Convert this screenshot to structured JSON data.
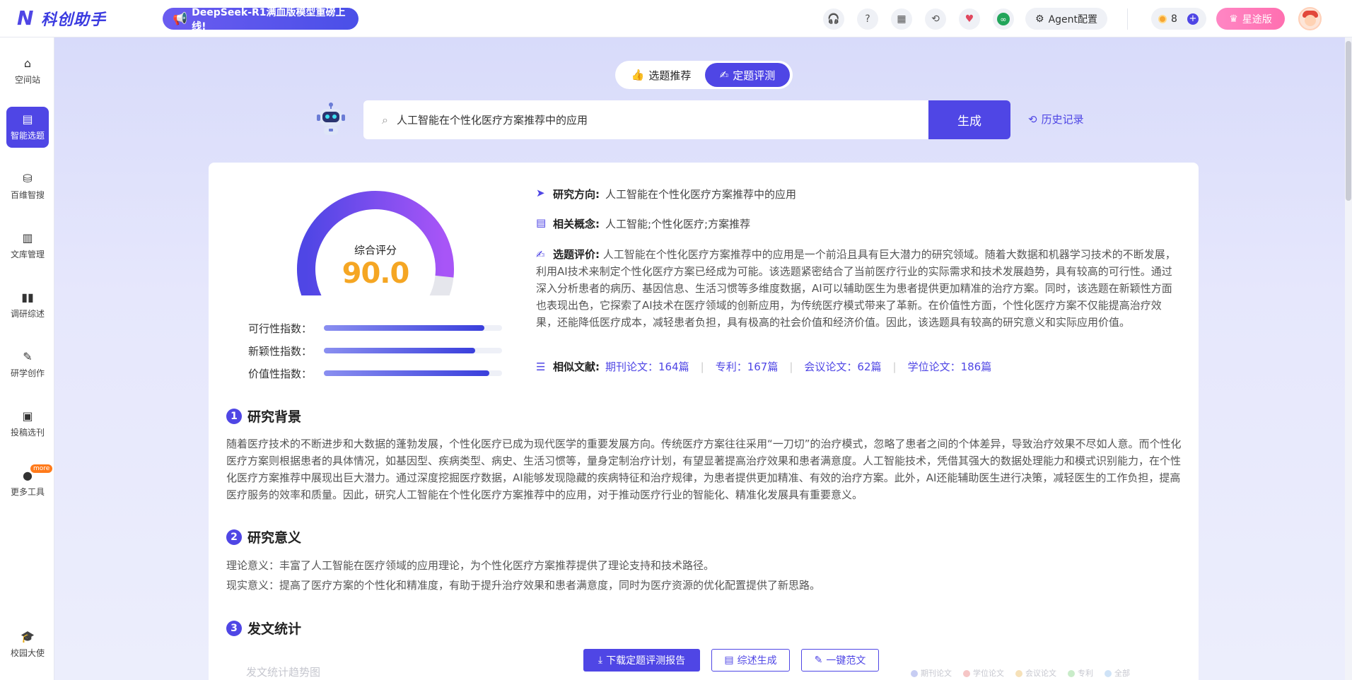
{
  "app": {
    "logo_text": "科创助手",
    "promo": "DeepSeek-R1满血版模型重磅上线!",
    "agent_label": "Agent配置",
    "coins": "8",
    "vip_label": "星途版"
  },
  "sidebar": {
    "items": [
      {
        "label": "空间站",
        "icon": "home-icon"
      },
      {
        "label": "智能选题",
        "icon": "clipboard-icon"
      },
      {
        "label": "百维智搜",
        "icon": "search-db-icon"
      },
      {
        "label": "文库管理",
        "icon": "library-icon"
      },
      {
        "label": "调研综述",
        "icon": "book-icon"
      },
      {
        "label": "研学创作",
        "icon": "edit-icon"
      },
      {
        "label": "投稿选刊",
        "icon": "submit-icon"
      },
      {
        "label": "更多工具",
        "icon": "more-icon"
      },
      {
        "label": "校园大使",
        "icon": "graduation-cap-icon"
      }
    ],
    "more_badge": "more"
  },
  "tabs": {
    "recommend": "选题推荐",
    "evaluate": "定题评测"
  },
  "search": {
    "value": "人工智能在个性化医疗方案推荐中的应用",
    "generate": "生成",
    "history": "历史记录"
  },
  "score": {
    "label": "综合评分",
    "value": "90.0",
    "fraction": 0.9,
    "colors": {
      "start": "#4f46e5",
      "end": "#a855f7",
      "remainder": "#e5e6ec",
      "value": "#f5a623"
    },
    "metrics": [
      {
        "label": "可行性指数：",
        "fraction": 0.9
      },
      {
        "label": "新颖性指数：",
        "fraction": 0.85
      },
      {
        "label": "价值性指数：",
        "fraction": 0.93
      }
    ]
  },
  "info": {
    "direction_title": "研究方向:",
    "direction_value": "人工智能在个性化医疗方案推荐中的应用",
    "concept_title": "相关概念:",
    "concept_value": "人工智能;个性化医疗;方案推荐",
    "eval_title": "选题评价:",
    "eval_value": "人工智能在个性化医疗方案推荐中的应用是一个前沿且具有巨大潜力的研究领域。随着大数据和机器学习技术的不断发展，利用AI技术来制定个性化医疗方案已经成为可能。该选题紧密结合了当前医疗行业的实际需求和技术发展趋势，具有较高的可行性。通过深入分析患者的病历、基因信息、生活习惯等多维度数据，AI可以辅助医生为患者提供更加精准的治疗方案。同时，该选题在新颖性方面也表现出色，它探索了AI技术在医疗领域的创新应用，为传统医疗模式带来了革新。在价值性方面，个性化医疗方案不仅能提高治疗效果，还能降低医疗成本，减轻患者负担，具有极高的社会价值和经济价值。因此，该选题具有较高的研究意义和实际应用价值。",
    "refs_title": "相似文献:",
    "refs": [
      "期刊论文：164篇",
      "专利：167篇",
      "会议论文：62篇",
      "学位论文：186篇"
    ]
  },
  "sections": {
    "s1_num": "1",
    "s1_title": "研究背景",
    "s1_text": "随着医疗技术的不断进步和大数据的蓬勃发展，个性化医疗已成为现代医学的重要发展方向。传统医疗方案往往采用“一刀切”的治疗模式，忽略了患者之间的个体差异，导致治疗效果不尽如人意。而个性化医疗方案则根据患者的具体情况，如基因型、疾病类型、病史、生活习惯等，量身定制治疗计划，有望显著提高治疗效果和患者满意度。人工智能技术，凭借其强大的数据处理能力和模式识别能力，在个性化医疗方案推荐中展现出巨大潜力。通过深度挖掘医疗数据，AI能够发现隐藏的疾病特征和治疗规律，为患者提供更加精准、有效的治疗方案。此外，AI还能辅助医生进行决策，减轻医生的工作负担，提高医疗服务的效率和质量。因此，研究人工智能在个性化医疗方案推荐中的应用，对于推动医疗行业的智能化、精准化发展具有重要意义。",
    "s2_num": "2",
    "s2_title": "研究意义",
    "s2_line1": "理论意义：丰富了人工智能在医疗领域的应用理论，为个性化医疗方案推荐提供了理论支持和技术路径。",
    "s2_line2": "现实意义：提高了医疗方案的个性化和精准度，有助于提升治疗效果和患者满意度，同时为医疗资源的优化配置提供了新思路。",
    "s3_num": "3",
    "s3_title": "发文统计",
    "s3_sub": "发文统计趋势图"
  },
  "actions": {
    "download": "下载定题评测报告",
    "review": "综述生成",
    "sample": "一键范文"
  },
  "legend": [
    "期刊论文",
    "学位论文",
    "会议论文",
    "专利",
    "全部"
  ]
}
